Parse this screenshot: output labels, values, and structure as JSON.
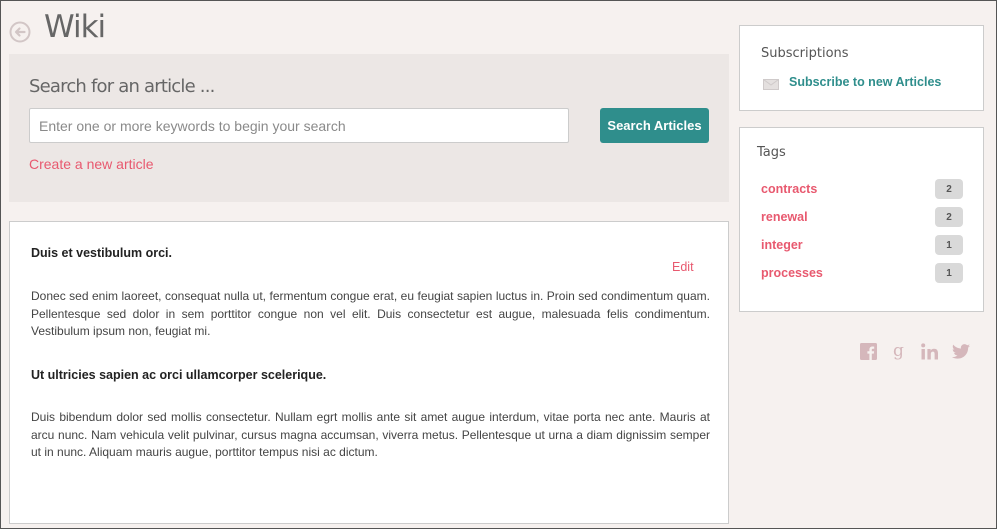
{
  "header": {
    "title": "Wiki",
    "back_icon": "back-arrow-circle-icon"
  },
  "search": {
    "heading": "Search for an article ...",
    "placeholder": "Enter one or more keywords to begin your search",
    "value": "",
    "button_label": "Search Articles",
    "create_link": "Create a new article"
  },
  "article": {
    "sections": [
      {
        "title": "Duis et vestibulum orci.",
        "body": "Donec sed enim laoreet, consequat nulla ut, fermentum congue erat, eu feugiat sapien luctus in. Proin sed condimentum quam. Pellentesque sed dolor in sem porttitor congue non vel elit. Duis consectetur est augue, malesuada felis condimentum. Vestibulum ipsum non, feugiat mi."
      },
      {
        "title": "Ut ultricies sapien ac orci ullamcorper scelerique.",
        "body": "Duis bibendum dolor sed mollis consectetur. Nullam egrt mollis ante sit amet augue interdum, vitae porta nec ante. Mauris at arcu nunc. Nam vehicula velit pulvinar, cursus magna accumsan, viverra metus. Pellentesque ut urna a diam dignissim semper ut in nunc. Aliquam mauris augue, porttitor tempus nisi ac dictum."
      }
    ],
    "edit_label": "Edit"
  },
  "subscriptions": {
    "title": "Subscriptions",
    "link": "Subscribe to new Articles",
    "icon": "mail-icon"
  },
  "tags": {
    "title": "Tags",
    "items": [
      {
        "name": "contracts",
        "count": "2"
      },
      {
        "name": "renewal",
        "count": "2"
      },
      {
        "name": "integer",
        "count": "1"
      },
      {
        "name": "processes",
        "count": "1"
      }
    ]
  },
  "social": [
    "facebook-icon",
    "google-plus-icon",
    "linkedin-icon",
    "twitter-icon"
  ],
  "colors": {
    "accent": "#2f8e8c",
    "link": "#e8596f",
    "background": "#f6f1ef",
    "panel": "#ece7e5"
  }
}
